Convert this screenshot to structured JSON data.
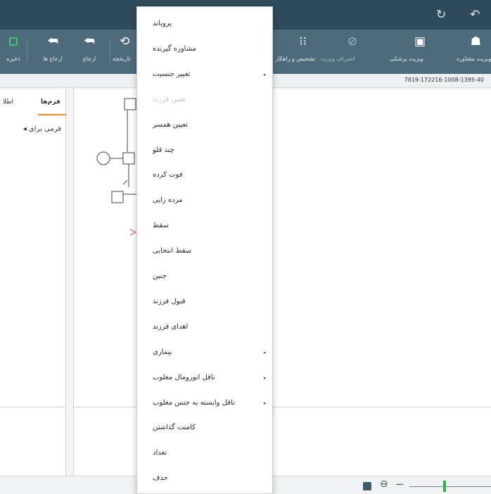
{
  "titlebar": {
    "redo_icon": "redo-arrow-icon",
    "undo_icon": "undo-arrow-icon"
  },
  "toolbar": {
    "save_label": "ذخیره",
    "refer_label": "ارجاع ها",
    "refer2_label": "ارجاع",
    "history_label": "تاریخچه",
    "diagnosis_label": "تشخیص و راهکار",
    "cancel_visit_label": "انصراف ویزیت",
    "medical_visit_label": "ویزیت پزشکی",
    "consult_label": "ویزیت مشاوره"
  },
  "id_strip": {
    "text": "7819-172216-1008-1395-40"
  },
  "side_panel": {
    "tab_forms": "فرم‌ها",
    "tab_info": "اطلا",
    "form_item": "◂ فرمی برای"
  },
  "context_menu": {
    "items": [
      {
        "label": "پروباند",
        "disabled": false,
        "submenu": false
      },
      {
        "label": "مشاوره گیرنده",
        "disabled": false,
        "submenu": false
      },
      {
        "label": "تغییر جنسیت",
        "disabled": false,
        "submenu": true
      },
      {
        "label": "تعیین فرزند",
        "disabled": true,
        "submenu": false
      },
      {
        "label": "تعیین همسر",
        "disabled": false,
        "submenu": false
      },
      {
        "label": "چند قلو",
        "disabled": false,
        "submenu": false
      },
      {
        "label": "فوت کرده",
        "disabled": false,
        "submenu": false
      },
      {
        "label": "مرده زایی",
        "disabled": false,
        "submenu": false
      },
      {
        "label": "سقط",
        "disabled": false,
        "submenu": false
      },
      {
        "label": "سقط انتخابی",
        "disabled": false,
        "submenu": false
      },
      {
        "label": "جنین",
        "disabled": false,
        "submenu": false
      },
      {
        "label": "قبول فرزند",
        "disabled": false,
        "submenu": false
      },
      {
        "label": "اهدای فرزند",
        "disabled": false,
        "submenu": false
      },
      {
        "label": "بیماری",
        "disabled": false,
        "submenu": true
      },
      {
        "label": "ناقل اتوزومال مغلوب",
        "disabled": false,
        "submenu": true
      },
      {
        "label": "ناقل وابسته به جنس مغلوب",
        "disabled": false,
        "submenu": true
      },
      {
        "label": "کامنت گذاشتن",
        "disabled": false,
        "submenu": false
      },
      {
        "label": "تعداد",
        "disabled": false,
        "submenu": false
      },
      {
        "label": "حذف",
        "disabled": false,
        "submenu": false
      }
    ]
  },
  "colors": {
    "titlebar": "#2f4a5a",
    "toolbar": "#4e6b7b",
    "accent_tab": "#f08a24",
    "save_green": "#3fca6b",
    "zoom_thumb": "#2bb14f"
  }
}
